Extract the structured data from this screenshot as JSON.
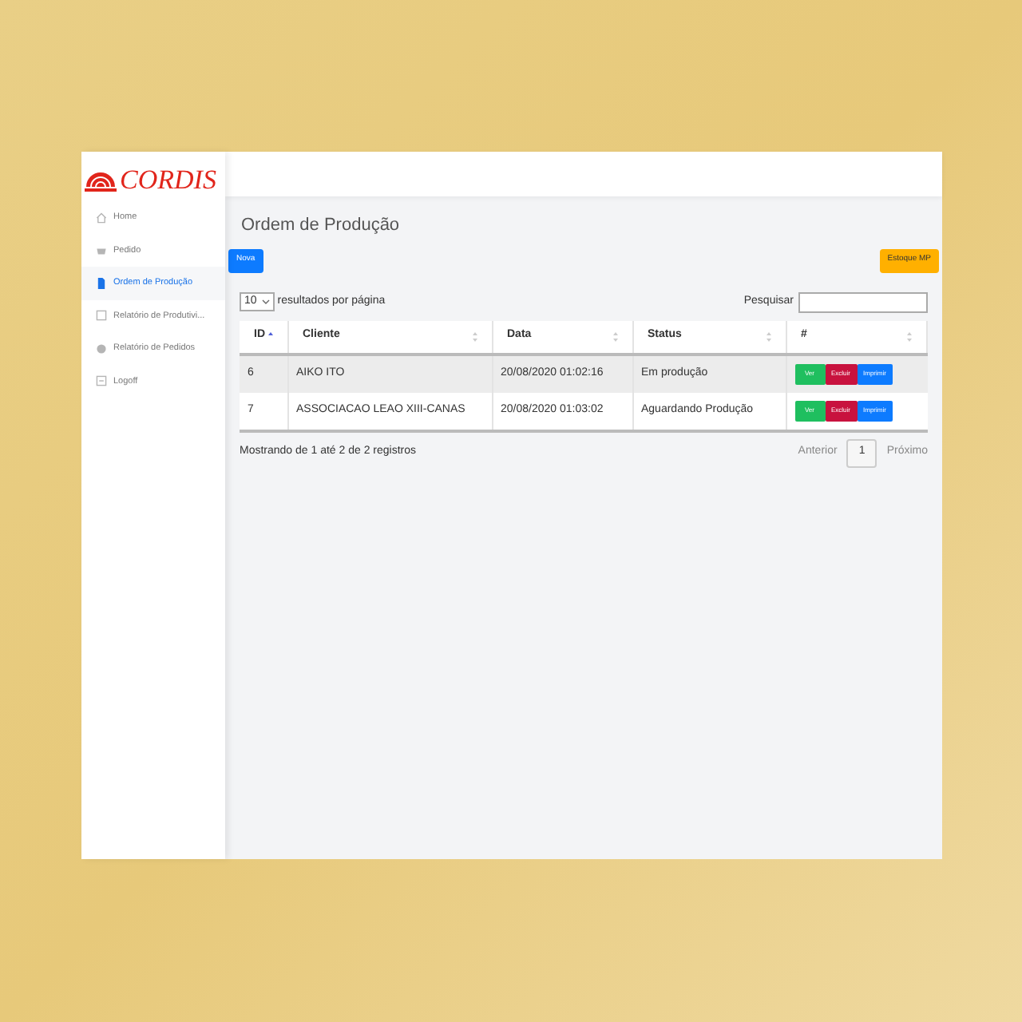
{
  "brand": {
    "name": "CORDIS"
  },
  "sidebar": {
    "items": [
      {
        "label": "Home",
        "kind": "home",
        "selected": false
      },
      {
        "label": "Pedido",
        "kind": "basket",
        "selected": false
      },
      {
        "label": "Ordem de Produção",
        "kind": "file",
        "selected": true
      },
      {
        "label": "Relatório de Produtivi...",
        "kind": "square",
        "selected": false
      },
      {
        "label": "Relatório de Pedidos",
        "kind": "circle",
        "selected": false
      },
      {
        "label": "Logoff",
        "kind": "logout",
        "selected": false
      }
    ]
  },
  "page": {
    "title": "Ordem de Produção",
    "new_button": "Nova",
    "stock_button": "Estoque MP"
  },
  "table_controls": {
    "page_size": "10",
    "page_size_label": "resultados por página",
    "search_label": "Pesquisar"
  },
  "table": {
    "columns": [
      {
        "label": "ID",
        "sorted": true
      },
      {
        "label": "Cliente",
        "sorted": false
      },
      {
        "label": "Data",
        "sorted": false
      },
      {
        "label": "Status",
        "sorted": false
      },
      {
        "label": "#",
        "sorted": false
      }
    ],
    "rows": [
      {
        "id": "6",
        "cliente": "AIKO ITO",
        "data": "20/08/2020 01:02:16",
        "status": "Em produção",
        "actions": [
          {
            "label": "Ver",
            "kind": "view"
          },
          {
            "label": "Excluir",
            "kind": "delete"
          },
          {
            "label": "Imprimir",
            "kind": "print"
          }
        ]
      },
      {
        "id": "7",
        "cliente": "ASSOCIACAO LEAO XIII-CANAS",
        "data": "20/08/2020 01:03:02",
        "status": "Aguardando Produção",
        "actions": [
          {
            "label": "Ver",
            "kind": "view"
          },
          {
            "label": "Excluir",
            "kind": "delete"
          },
          {
            "label": "Imprimir",
            "kind": "print"
          }
        ]
      }
    ]
  },
  "footer": {
    "info": "Mostrando de 1 até 2 de 2 registros",
    "prev": "Anterior",
    "pages": [
      {
        "label": "1",
        "selected": true
      }
    ],
    "next": "Próximo"
  }
}
